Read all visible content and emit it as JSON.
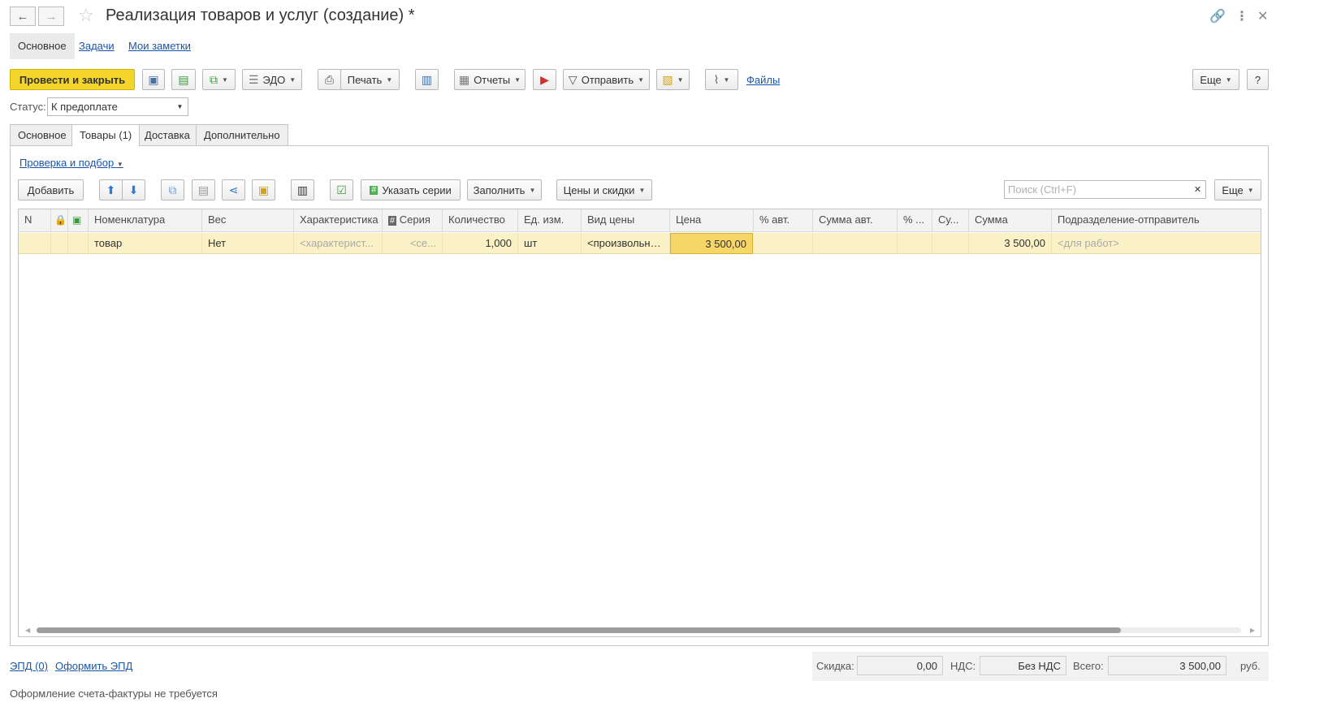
{
  "window": {
    "title": "Реализация товаров и услуг (создание) *"
  },
  "sections": [
    "Основное",
    "Задачи",
    "Мои заметки"
  ],
  "toolbar": {
    "post_close": "Провести и закрыть",
    "edo": "ЭДО",
    "print": "Печать",
    "reports": "Отчеты",
    "send": "Отправить",
    "files": "Файлы",
    "more": "Еще",
    "help": "?"
  },
  "status": {
    "label": "Статус:",
    "value": "К предоплате"
  },
  "tabs": [
    "Основное",
    "Товары (1)",
    "Доставка",
    "Дополнительно"
  ],
  "goods": {
    "check_link": "Проверка и подбор",
    "add": "Добавить",
    "series": "Указать серии",
    "fill": "Заполнить",
    "prices": "Цены и скидки",
    "search_placeholder": "Поиск (Ctrl+F)",
    "more": "Еще",
    "columns": [
      "N",
      "Номенклатура",
      "Вес",
      "Характеристика",
      "Серия",
      "Количество",
      "Ед. изм.",
      "Вид цены",
      "Цена",
      "% авт.",
      "Сумма авт.",
      "% ...",
      "Су...",
      "Сумма",
      "Подразделение-отправитель"
    ],
    "rows": [
      {
        "n": "",
        "item": "товар",
        "weight": "Нет",
        "characteristic": "<характерист...",
        "series": "<се...",
        "qty": "1,000",
        "unit": "шт",
        "price_type": "<произвольна...",
        "price": "3 500,00",
        "auto_pct": "",
        "auto_sum": "",
        "pct": "",
        "su": "",
        "sum": "3 500,00",
        "dept": "<для работ>"
      }
    ]
  },
  "footer": {
    "epd": "ЭПД (0)",
    "make_epd": "Оформить ЭПД",
    "discount_label": "Скидка:",
    "discount": "0,00",
    "vat_label": "НДС:",
    "vat": "Без НДС",
    "total_label": "Всего:",
    "total": "3 500,00",
    "currency": "руб.",
    "note": "Оформление счета-фактуры не требуется"
  }
}
